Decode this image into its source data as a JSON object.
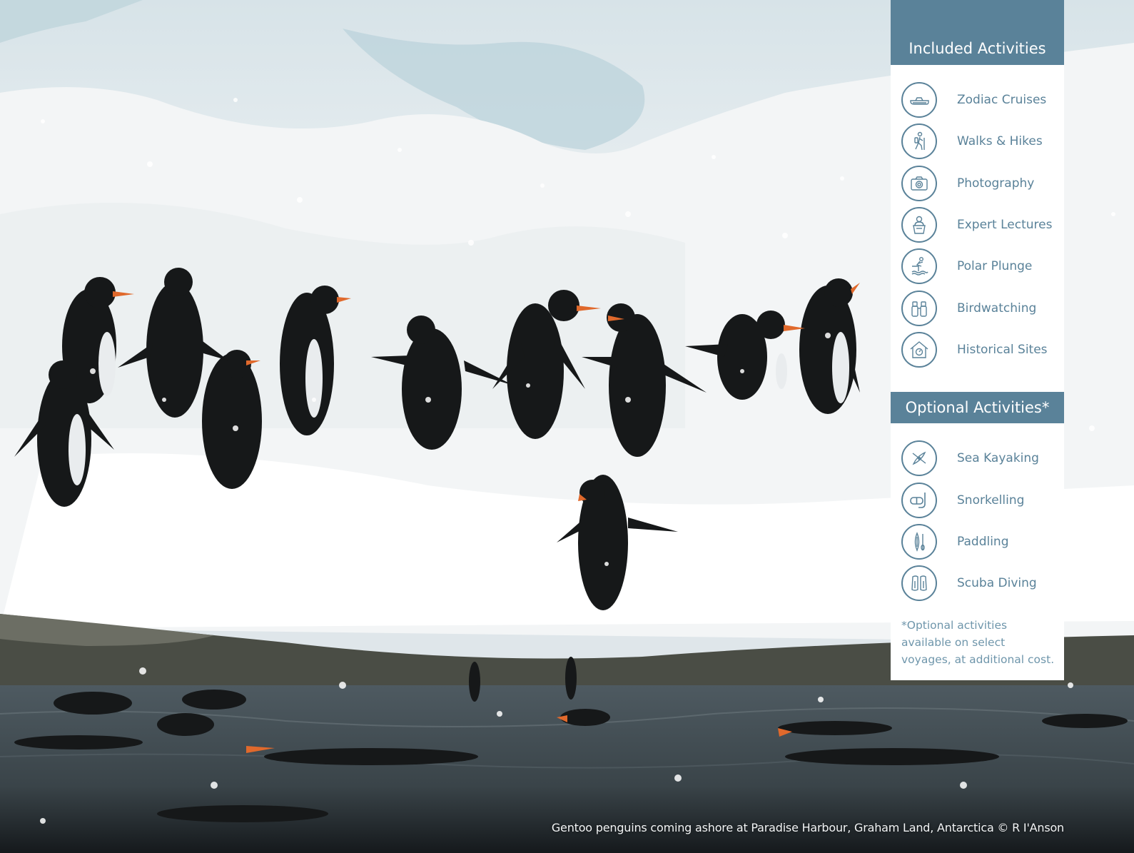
{
  "included": {
    "title": "Included Activities",
    "items": [
      {
        "label": "Zodiac Cruises",
        "icon": "zodiac-boat-icon"
      },
      {
        "label": "Walks & Hikes",
        "icon": "hiker-icon"
      },
      {
        "label": "Photography",
        "icon": "camera-icon"
      },
      {
        "label": "Expert Lectures",
        "icon": "lecturer-icon"
      },
      {
        "label": "Polar Plunge",
        "icon": "diver-plunge-icon"
      },
      {
        "label": "Birdwatching",
        "icon": "binoculars-icon"
      },
      {
        "label": "Historical Sites",
        "icon": "historic-house-icon"
      }
    ]
  },
  "optional": {
    "title": "Optional Activities*",
    "items": [
      {
        "label": "Sea Kayaking",
        "icon": "kayak-icon"
      },
      {
        "label": "Snorkelling",
        "icon": "snorkel-mask-icon"
      },
      {
        "label": "Paddling",
        "icon": "paddleboard-icon"
      },
      {
        "label": "Scuba Diving",
        "icon": "flippers-icon"
      }
    ],
    "note": "*Optional activities available on select voyages, at additional cost."
  },
  "caption": "Gentoo penguins coming ashore at Paradise Harbour, Graham Land, Antarctica © R I'Anson",
  "colors": {
    "accent": "#5a8299",
    "panel_bg": "#ffffff",
    "note_text": "#6f96ab"
  }
}
